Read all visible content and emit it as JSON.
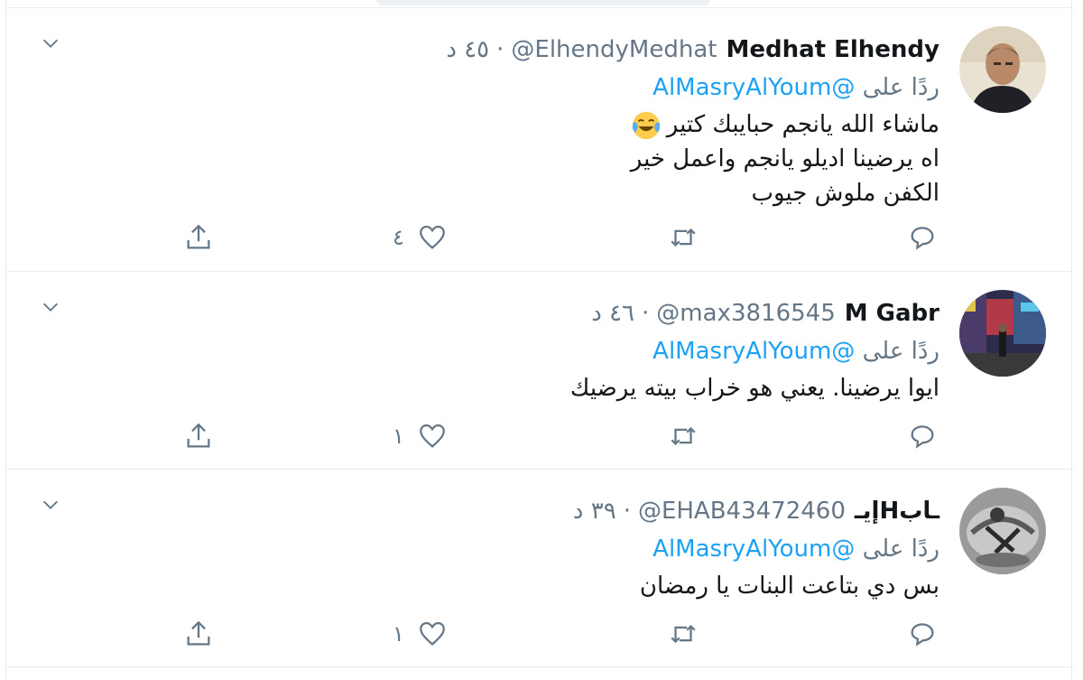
{
  "icons": {
    "caret": "chevron-down-icon",
    "reply": "reply-bubble-icon",
    "retweet": "retweet-icon",
    "like": "heart-icon",
    "share": "share-upload-icon",
    "emoji": "face-with-tears-of-joy-emoji"
  },
  "colors": {
    "link": "#1da1f2",
    "muted": "#657786",
    "text": "#14171a",
    "border": "#e6ecf0"
  },
  "tweets": [
    {
      "name": "Medhat Elhendy",
      "handle": "@ElhendyMedhat",
      "separator": "·",
      "time": "٤٥ د",
      "reply_prefix": "ردًا على",
      "reply_mention": "@AlMasryAlYoum",
      "lines": [
        "ماشاء الله يانجم حبايبك كتير",
        "اه يرضينا اديلو يانجم واعمل خير",
        "الكفن ملوش جيوب"
      ],
      "likes": "٤"
    },
    {
      "name": "M Gabr",
      "handle": "@max3816545",
      "separator": "·",
      "time": "٤٦ د",
      "reply_prefix": "ردًا على",
      "reply_mention": "@AlMasryAlYoum",
      "lines": [
        "ايوا يرضينا. يعني هو خراب بيته يرضيك"
      ],
      "likes": "١"
    },
    {
      "name": "إيـHـاب",
      "handle": "@EHAB43472460",
      "separator": "·",
      "time": "٣٩ د",
      "reply_prefix": "ردًا على",
      "reply_mention": "@AlMasryAlYoum",
      "lines": [
        "بس دي بتاعت البنات يا رمضان"
      ],
      "likes": "١"
    }
  ]
}
